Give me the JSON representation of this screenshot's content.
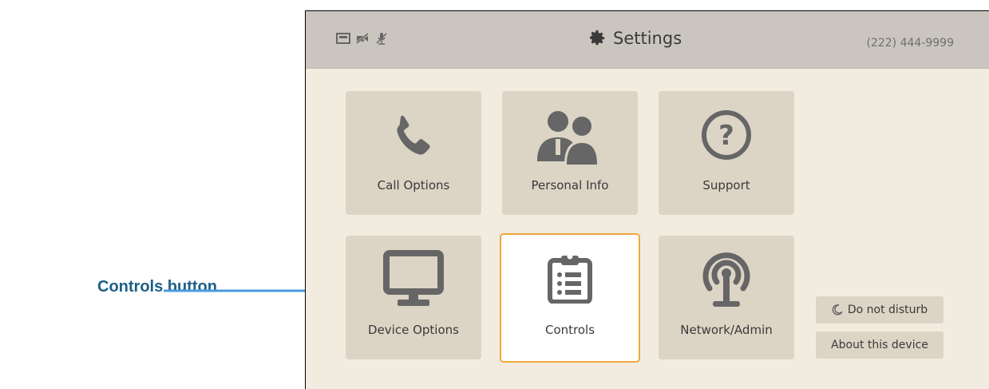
{
  "callout": {
    "label": "Controls button"
  },
  "header": {
    "title": "Settings",
    "phone_number": "(222) 444-9999",
    "status_icons": [
      "display-icon",
      "video-off-icon",
      "mic-off-icon"
    ]
  },
  "tiles": [
    {
      "label": "Call Options",
      "icon": "phone-icon"
    },
    {
      "label": "Personal Info",
      "icon": "people-icon"
    },
    {
      "label": "Support",
      "icon": "help-icon"
    },
    {
      "label": "Device Options",
      "icon": "monitor-icon"
    },
    {
      "label": "Controls",
      "icon": "clipboard-icon",
      "selected": true
    },
    {
      "label": "Network/Admin",
      "icon": "antenna-icon"
    }
  ],
  "side_buttons": {
    "do_not_disturb": "Do not disturb",
    "about": "About this device"
  },
  "colors": {
    "accent": "#f0a73c",
    "callout": "#1d5f86",
    "arrow": "#4a9be0",
    "tile": "#dcd4c5"
  }
}
